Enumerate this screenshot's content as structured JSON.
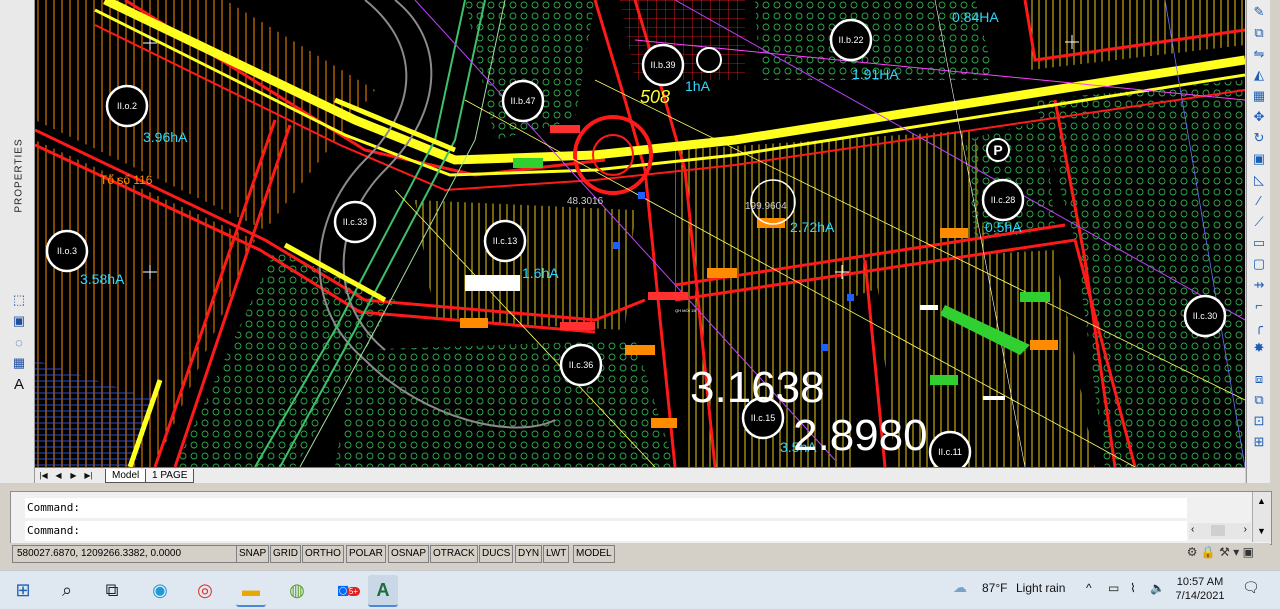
{
  "left_panel": {
    "properties_label": "PROPERTIES",
    "tool_glyphs": [
      "⬚",
      "▣",
      "◌",
      "▦",
      "A"
    ]
  },
  "drawing": {
    "circle_labels": [
      "II.o.2",
      "II.o.3",
      "II.c.33",
      "II.b.39",
      "II.b.47",
      "II.b.22",
      "II.c.13",
      "II.c.28",
      "II.c.36",
      "II.c.15",
      "II.c.11",
      "II.c.30"
    ],
    "area_labels": [
      "3.96hA",
      "3.58hA",
      "1.91HA",
      "0.84HA",
      "1hA",
      "2.72hA",
      "0.5hA",
      "1.6hA",
      "3.5hA"
    ],
    "big_numbers": [
      "3.1638",
      "2.8980"
    ],
    "dimension_texts": [
      "48.3016",
      "199.9604",
      "508"
    ],
    "misc_texts": [
      "Tổ số 116",
      "QH MỚI 15"
    ],
    "parking_symbol": "P"
  },
  "layout_tabs": {
    "nav": [
      "|◀",
      "◀",
      "▶",
      "▶|"
    ],
    "tabs": [
      "Model",
      "1 PAGE"
    ]
  },
  "command": {
    "line1": "Command:",
    "line2": "Command:"
  },
  "status_bar": {
    "coordinates": "580027.6870, 1209266.3382, 0.0000",
    "toggles": [
      "SNAP",
      "GRID",
      "ORTHO",
      "POLAR",
      "OSNAP",
      "OTRACK",
      "DUCS",
      "DYN",
      "LWT",
      "MODEL"
    ]
  },
  "taskbar": {
    "apps": [
      "windows-start",
      "search",
      "task-view",
      "edge",
      "chrome",
      "file-explorer",
      "greenshot",
      "zalo",
      "autocad"
    ],
    "zalo_badge": "5+",
    "weather_temp": "87°F",
    "weather_text": "Light rain",
    "time": "10:57 AM",
    "date": "7/14/2021"
  }
}
